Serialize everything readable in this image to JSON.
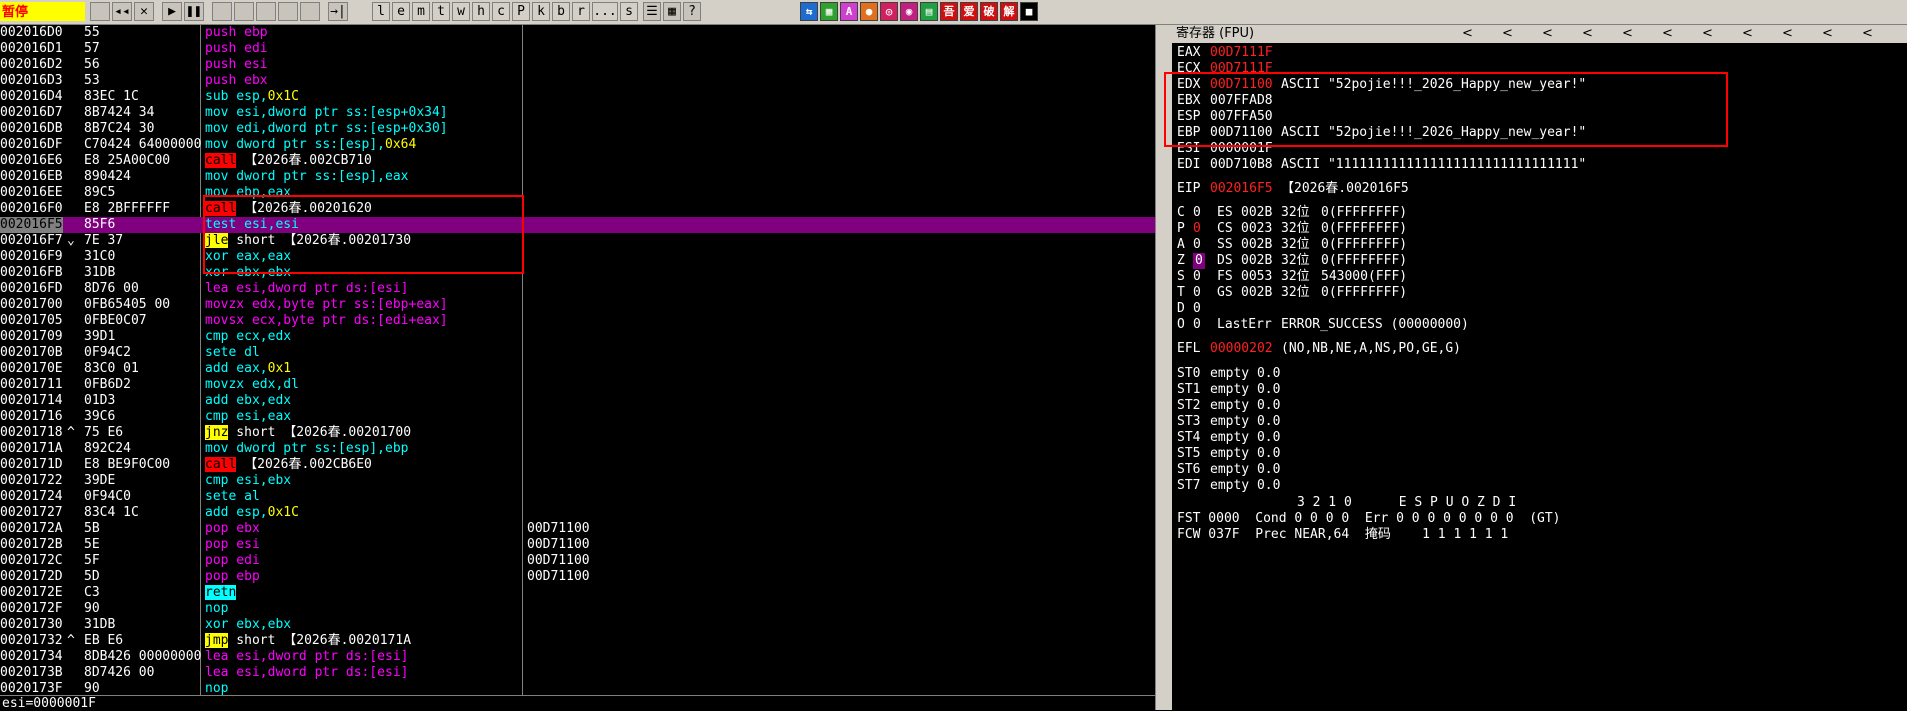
{
  "toolbar": {
    "status": "暂停",
    "buttons": [
      {
        "name": "open-file-icon",
        "label": ""
      },
      {
        "name": "rewind-icon",
        "label": "◂◂"
      },
      {
        "name": "close-icon",
        "label": "✕"
      },
      {
        "name": "run-icon",
        "label": "▶"
      },
      {
        "name": "pause-icon",
        "label": "❚❚"
      },
      {
        "name": "step-into-icon",
        "label": ""
      },
      {
        "name": "step-over-icon",
        "label": ""
      },
      {
        "name": "trace-into-icon",
        "label": ""
      },
      {
        "name": "trace-over-icon",
        "label": ""
      },
      {
        "name": "execute-till-return-icon",
        "label": ""
      },
      {
        "name": "goto-icon",
        "label": "→|"
      }
    ],
    "letters": [
      "l",
      "e",
      "m",
      "t",
      "w",
      "h",
      "c",
      "P",
      "k",
      "b",
      "r",
      "...",
      "s"
    ],
    "tools": [
      {
        "name": "list-icon",
        "label": "☰"
      },
      {
        "name": "grid-icon",
        "label": "▦"
      },
      {
        "name": "help-icon",
        "label": "?"
      }
    ],
    "plugins": [
      {
        "name": "plugin-1-icon",
        "label": "⇆",
        "color": "#1e6ccf"
      },
      {
        "name": "plugin-2-icon",
        "label": "▦",
        "color": "#30a030"
      },
      {
        "name": "plugin-3-icon",
        "label": "A",
        "color": "#d040d0"
      },
      {
        "name": "plugin-4-icon",
        "label": "●",
        "color": "#e07020"
      },
      {
        "name": "plugin-5-icon",
        "label": "◎",
        "color": "#d02060"
      },
      {
        "name": "plugin-6-icon",
        "label": "◉",
        "color": "#c02080"
      },
      {
        "name": "plugin-7-icon",
        "label": "▤",
        "color": "#20a040"
      },
      {
        "name": "plugin-8-icon",
        "label": "吾",
        "color": "#d01010"
      },
      {
        "name": "plugin-9-icon",
        "label": "爱",
        "color": "#d01010"
      },
      {
        "name": "plugin-10-icon",
        "label": "破",
        "color": "#d01010"
      },
      {
        "name": "plugin-11-icon",
        "label": "解",
        "color": "#d01010"
      },
      {
        "name": "plugin-12-icon",
        "label": "■",
        "color": "#000000"
      }
    ]
  },
  "cpu_rows": [
    {
      "addr": "002016D0",
      "arr": "",
      "hex": "55",
      "asm": [
        [
          "push",
          "k-push"
        ],
        [
          " ebp",
          "k-push"
        ]
      ],
      "cmt": ""
    },
    {
      "addr": "002016D1",
      "arr": "",
      "hex": "57",
      "asm": [
        [
          "push",
          "k-push"
        ],
        [
          " edi",
          "k-push"
        ]
      ],
      "cmt": ""
    },
    {
      "addr": "002016D2",
      "arr": "",
      "hex": "56",
      "asm": [
        [
          "push",
          "k-push"
        ],
        [
          " esi",
          "k-push"
        ]
      ],
      "cmt": ""
    },
    {
      "addr": "002016D3",
      "arr": "",
      "hex": "53",
      "asm": [
        [
          "push",
          "k-push"
        ],
        [
          " ebx",
          "k-push"
        ]
      ],
      "cmt": ""
    },
    {
      "addr": "002016D4",
      "arr": "",
      "hex": "83EC 1C",
      "asm": [
        [
          "sub esp,",
          "op"
        ],
        [
          "0x1C",
          "imm"
        ]
      ],
      "cmt": ""
    },
    {
      "addr": "002016D7",
      "arr": "",
      "hex": "8B7424 34",
      "asm": [
        [
          "mov esi,dword ptr ss:[esp+0x34]",
          "op"
        ]
      ],
      "cmt": ""
    },
    {
      "addr": "002016DB",
      "arr": "",
      "hex": "8B7C24 30",
      "asm": [
        [
          "mov edi,dword ptr ss:[esp+0x30]",
          "op"
        ]
      ],
      "cmt": ""
    },
    {
      "addr": "002016DF",
      "arr": "",
      "hex": "C70424 64000000",
      "asm": [
        [
          "mov dword ptr ss:[esp],",
          "op"
        ],
        [
          "0x64",
          "imm"
        ]
      ],
      "cmt": ""
    },
    {
      "addr": "002016E6",
      "arr": "",
      "hex": "E8 25A00C00",
      "asm": [
        [
          "call",
          "k-call"
        ],
        [
          " 【2026春.002CB710",
          "tgt"
        ]
      ],
      "cmt": ""
    },
    {
      "addr": "002016EB",
      "arr": "",
      "hex": "890424",
      "asm": [
        [
          "mov dword ptr ss:[esp],eax",
          "op"
        ]
      ],
      "cmt": ""
    },
    {
      "addr": "002016EE",
      "arr": "",
      "hex": "89C5",
      "asm": [
        [
          "mov ebp,eax",
          "op"
        ]
      ],
      "cmt": ""
    },
    {
      "addr": "002016F0",
      "arr": "",
      "hex": "E8 2BFFFFFF",
      "asm": [
        [
          "call",
          "k-call"
        ],
        [
          " 【2026春.00201620",
          "tgt"
        ]
      ],
      "cmt": ""
    },
    {
      "addr": "002016F5",
      "arr": "",
      "hex": "85F6",
      "asm": [
        [
          "test esi,esi",
          "op"
        ]
      ],
      "cmt": "",
      "sel": true
    },
    {
      "addr": "002016F7",
      "arr": "⌄",
      "hex": "7E 37",
      "asm": [
        [
          "jle",
          "k-jmp"
        ],
        [
          " short 【2026春.00201730",
          "tgt"
        ]
      ],
      "cmt": ""
    },
    {
      "addr": "002016F9",
      "arr": "",
      "hex": "31C0",
      "asm": [
        [
          "xor eax,eax",
          "op"
        ]
      ],
      "cmt": ""
    },
    {
      "addr": "002016FB",
      "arr": "",
      "hex": "31DB",
      "asm": [
        [
          "xor ebx,ebx",
          "op"
        ]
      ],
      "cmt": ""
    },
    {
      "addr": "002016FD",
      "arr": "",
      "hex": "8D76 00",
      "asm": [
        [
          "lea esi,dword ptr ds:[esi]",
          "memc"
        ]
      ],
      "cmt": ""
    },
    {
      "addr": "00201700",
      "arr": "",
      "hex": "0FB65405 00",
      "asm": [
        [
          "movzx edx,byte ptr ss:[ebp+eax]",
          "memc"
        ]
      ],
      "cmt": ""
    },
    {
      "addr": "00201705",
      "arr": "",
      "hex": "0FBE0C07",
      "asm": [
        [
          "movsx ecx,byte ptr ds:[edi+eax]",
          "memc"
        ]
      ],
      "cmt": ""
    },
    {
      "addr": "00201709",
      "arr": "",
      "hex": "39D1",
      "asm": [
        [
          "cmp ecx,edx",
          "op"
        ]
      ],
      "cmt": ""
    },
    {
      "addr": "0020170B",
      "arr": "",
      "hex": "0F94C2",
      "asm": [
        [
          "sete dl",
          "op"
        ]
      ],
      "cmt": ""
    },
    {
      "addr": "0020170E",
      "arr": "",
      "hex": "83C0 01",
      "asm": [
        [
          "add eax,",
          "op"
        ],
        [
          "0x1",
          "imm"
        ]
      ],
      "cmt": ""
    },
    {
      "addr": "00201711",
      "arr": "",
      "hex": "0FB6D2",
      "asm": [
        [
          "movzx edx,dl",
          "op"
        ]
      ],
      "cmt": ""
    },
    {
      "addr": "00201714",
      "arr": "",
      "hex": "01D3",
      "asm": [
        [
          "add ebx,edx",
          "op"
        ]
      ],
      "cmt": ""
    },
    {
      "addr": "00201716",
      "arr": "",
      "hex": "39C6",
      "asm": [
        [
          "cmp esi,eax",
          "op"
        ]
      ],
      "cmt": ""
    },
    {
      "addr": "00201718",
      "arr": "^",
      "hex": "75 E6",
      "asm": [
        [
          "jnz",
          "k-jmp"
        ],
        [
          " short 【2026春.00201700",
          "tgt"
        ]
      ],
      "cmt": ""
    },
    {
      "addr": "0020171A",
      "arr": "",
      "hex": "892C24",
      "asm": [
        [
          "mov dword ptr ss:[esp],ebp",
          "op"
        ]
      ],
      "cmt": ""
    },
    {
      "addr": "0020171D",
      "arr": "",
      "hex": "E8 BE9F0C00",
      "asm": [
        [
          "call",
          "k-call"
        ],
        [
          " 【2026春.002CB6E0",
          "tgt"
        ]
      ],
      "cmt": ""
    },
    {
      "addr": "00201722",
      "arr": "",
      "hex": "39DE",
      "asm": [
        [
          "cmp esi,ebx",
          "op"
        ]
      ],
      "cmt": ""
    },
    {
      "addr": "00201724",
      "arr": "",
      "hex": "0F94C0",
      "asm": [
        [
          "sete al",
          "op"
        ]
      ],
      "cmt": ""
    },
    {
      "addr": "00201727",
      "arr": "",
      "hex": "83C4 1C",
      "asm": [
        [
          "add esp,",
          "op"
        ],
        [
          "0x1C",
          "imm"
        ]
      ],
      "cmt": ""
    },
    {
      "addr": "0020172A",
      "arr": "",
      "hex": "5B",
      "asm": [
        [
          "pop ebx",
          "k-push"
        ]
      ],
      "cmt": "00D71100"
    },
    {
      "addr": "0020172B",
      "arr": "",
      "hex": "5E",
      "asm": [
        [
          "pop esi",
          "k-push"
        ]
      ],
      "cmt": "00D71100"
    },
    {
      "addr": "0020172C",
      "arr": "",
      "hex": "5F",
      "asm": [
        [
          "pop edi",
          "k-push"
        ]
      ],
      "cmt": "00D71100"
    },
    {
      "addr": "0020172D",
      "arr": "",
      "hex": "5D",
      "asm": [
        [
          "pop ebp",
          "k-push"
        ]
      ],
      "cmt": "00D71100"
    },
    {
      "addr": "0020172E",
      "arr": "",
      "hex": "C3",
      "asm": [
        [
          "retn",
          "k-retn"
        ]
      ],
      "cmt": ""
    },
    {
      "addr": "0020172F",
      "arr": "",
      "hex": "90",
      "asm": [
        [
          "nop",
          "op"
        ]
      ],
      "cmt": ""
    },
    {
      "addr": "00201730",
      "arr": "",
      "hex": "31DB",
      "asm": [
        [
          "xor ebx,ebx",
          "op"
        ]
      ],
      "cmt": ""
    },
    {
      "addr": "00201732",
      "arr": "^",
      "hex": "EB E6",
      "asm": [
        [
          "jmp",
          "k-jmp"
        ],
        [
          " short 【2026春.0020171A",
          "tgt"
        ]
      ],
      "cmt": ""
    },
    {
      "addr": "00201734",
      "arr": "",
      "hex": "8DB426 00000000",
      "asm": [
        [
          "lea esi,dword ptr ds:[esi]",
          "memc"
        ]
      ],
      "cmt": ""
    },
    {
      "addr": "0020173B",
      "arr": "",
      "hex": "8D7426 00",
      "asm": [
        [
          "lea esi,dword ptr ds:[esi]",
          "memc"
        ]
      ],
      "cmt": ""
    },
    {
      "addr": "0020173F",
      "arr": "",
      "hex": "90",
      "asm": [
        [
          "nop",
          "op"
        ]
      ],
      "cmt": ""
    }
  ],
  "cpu_status": "esi=0000001F",
  "registers_panel": {
    "title": "寄存器 (FPU)",
    "chevrons": [
      "<",
      "<",
      "<",
      "<",
      "<",
      "<",
      "<",
      "<",
      "<",
      "<",
      "<"
    ],
    "gp": [
      {
        "name": "EAX",
        "value": "00D7111F",
        "changed": true,
        "info": ""
      },
      {
        "name": "ECX",
        "value": "00D7111F",
        "changed": true,
        "info": ""
      },
      {
        "name": "EDX",
        "value": "00D71100",
        "changed": true,
        "info": "ASCII \"52pojie!!!_2026_Happy_new_year!\""
      },
      {
        "name": "EBX",
        "value": "007FFAD8",
        "changed": false,
        "info": ""
      },
      {
        "name": "ESP",
        "value": "007FFA50",
        "changed": false,
        "info": ""
      },
      {
        "name": "EBP",
        "value": "00D71100",
        "changed": false,
        "info": "ASCII \"52pojie!!!_2026_Happy_new_year!\""
      },
      {
        "name": "ESI",
        "value": "0000001F",
        "changed": false,
        "info": ""
      },
      {
        "name": "EDI",
        "value": "00D710B8",
        "changed": false,
        "info": "ASCII \"1111111111111111111111111111111\""
      }
    ],
    "eip": {
      "name": "EIP",
      "value": "002016F5",
      "info": "【2026春.002016F5"
    },
    "flags": [
      {
        "f": "C",
        "v": "0",
        "seg": "ES",
        "sel": "002B",
        "bits": "32位",
        "base": "0(FFFFFFFF)",
        "changed": false
      },
      {
        "f": "P",
        "v": "0",
        "seg": "CS",
        "sel": "0023",
        "bits": "32位",
        "base": "0(FFFFFFFF)",
        "changed": true
      },
      {
        "f": "A",
        "v": "0",
        "seg": "SS",
        "sel": "002B",
        "bits": "32位",
        "base": "0(FFFFFFFF)",
        "changed": false
      },
      {
        "f": "Z",
        "v": "0",
        "seg": "DS",
        "sel": "002B",
        "bits": "32位",
        "base": "0(FFFFFFFF)",
        "changed": true,
        "hl": true
      },
      {
        "f": "S",
        "v": "0",
        "seg": "FS",
        "sel": "0053",
        "bits": "32位",
        "base": "543000(FFF)",
        "changed": false
      },
      {
        "f": "T",
        "v": "0",
        "seg": "GS",
        "sel": "002B",
        "bits": "32位",
        "base": "0(FFFFFFFF)",
        "changed": false
      },
      {
        "f": "D",
        "v": "0",
        "seg": "",
        "sel": "",
        "bits": "",
        "base": "",
        "changed": false
      },
      {
        "f": "O",
        "v": "0",
        "seg": "LastErr",
        "sel": "ERROR_SUCCESS (00000000)",
        "bits": "",
        "base": "",
        "changed": false
      }
    ],
    "efl": {
      "name": "EFL",
      "value": "00000202",
      "info": "(NO,NB,NE,A,NS,PO,GE,G)"
    },
    "st": [
      {
        "name": "ST0",
        "value": "empty 0.0"
      },
      {
        "name": "ST1",
        "value": "empty 0.0"
      },
      {
        "name": "ST2",
        "value": "empty 0.0"
      },
      {
        "name": "ST3",
        "value": "empty 0.0"
      },
      {
        "name": "ST4",
        "value": "empty 0.0"
      },
      {
        "name": "ST5",
        "value": "empty 0.0"
      },
      {
        "name": "ST6",
        "value": "empty 0.0"
      },
      {
        "name": "ST7",
        "value": "empty 0.0"
      }
    ],
    "fpu_header": "3 2 1 0      E S P U O Z D I",
    "fst": "FST 0000  Cond 0 0 0 0  Err 0 0 0 0 0 0 0 0  (GT)",
    "fcw": "FCW 037F  Prec NEAR,64  掩码    1 1 1 1 1 1"
  }
}
